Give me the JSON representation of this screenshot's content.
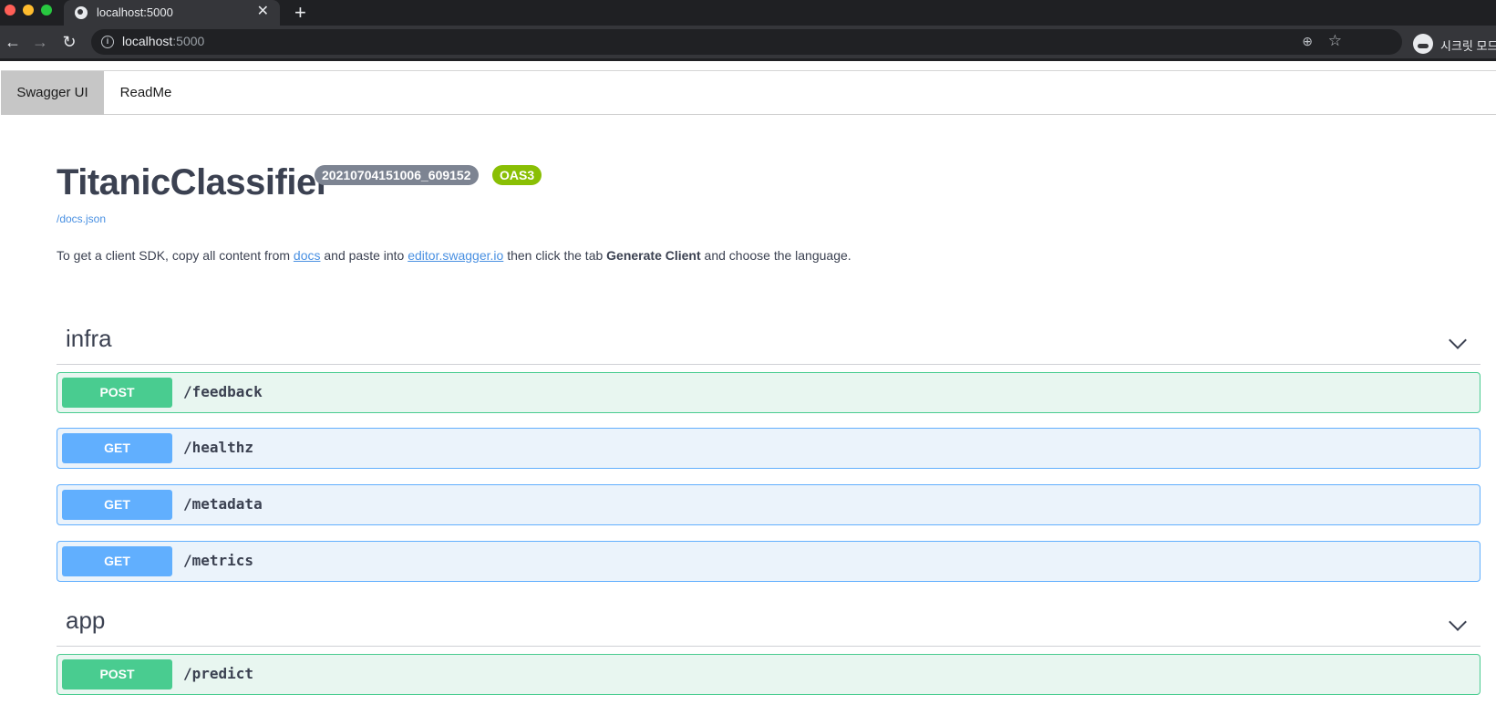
{
  "browser": {
    "tab_title": "localhost:5000",
    "url_host": "localhost",
    "url_port": ":5000",
    "incognito_label": "시크릿 모드"
  },
  "nav": {
    "tabs": [
      {
        "label": "Swagger UI",
        "active": true
      },
      {
        "label": "ReadMe",
        "active": false
      }
    ]
  },
  "info": {
    "title": "TitanicClassifier",
    "version_badge": "20210704151006_609152",
    "oas_badge": "OAS3",
    "docs_link": "/docs.json",
    "description": {
      "part1": "To get a client SDK, copy all content from ",
      "link1": "docs",
      "part2": " and paste into ",
      "link2": "editor.swagger.io",
      "part3": " then click the tab ",
      "bold": "Generate Client",
      "part4": " and choose the language."
    }
  },
  "sections": [
    {
      "name": "infra",
      "operations": [
        {
          "method": "POST",
          "path": "/feedback"
        },
        {
          "method": "GET",
          "path": "/healthz"
        },
        {
          "method": "GET",
          "path": "/metadata"
        },
        {
          "method": "GET",
          "path": "/metrics"
        }
      ]
    },
    {
      "name": "app",
      "operations": [
        {
          "method": "POST",
          "path": "/predict"
        }
      ]
    }
  ],
  "colors": {
    "post": "#49cc90",
    "get": "#61affe",
    "text": "#3b4151",
    "link": "#4990e2",
    "oas_badge": "#89bf04",
    "version_badge": "#7d8492"
  }
}
